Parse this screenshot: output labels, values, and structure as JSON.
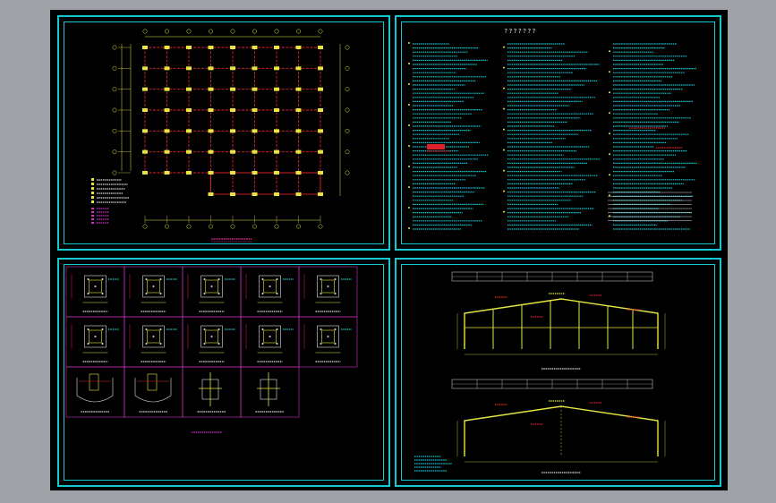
{
  "window": {
    "name": "cad-viewer"
  },
  "sheets": [
    {
      "id": "foundation-plan",
      "caption_color": "#ff2ea6"
    },
    {
      "id": "general-notes",
      "title": "???????"
    },
    {
      "id": "base-details"
    },
    {
      "id": "frame-elevations"
    }
  ],
  "colors": {
    "background": "#9ea2a6",
    "drawing_area": "#000000",
    "frame": "#14c8d2",
    "column": "#e6e640",
    "grid": "#e0202a",
    "text_note": "#14c8d2",
    "magenta": "#d030c8",
    "red_note": "#e0202a"
  }
}
